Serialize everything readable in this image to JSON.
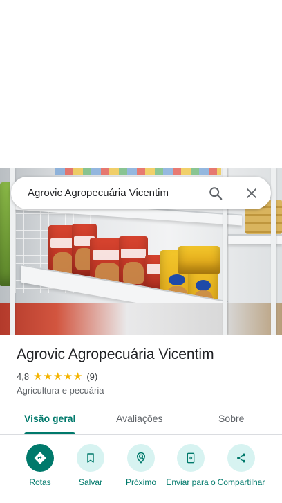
{
  "search": {
    "query": "Agrovic Agropecuária Vicentim",
    "search_icon": "search-icon",
    "close_icon": "close-icon"
  },
  "place": {
    "name": "Agrovic Agropecuária Vicentim",
    "rating": "4,8",
    "stars": 5,
    "review_count": "(9)",
    "category": "Agricultura e pecuária"
  },
  "tabs": [
    {
      "label": "Visão geral",
      "active": true
    },
    {
      "label": "Avaliações",
      "active": false
    },
    {
      "label": "Sobre",
      "active": false
    }
  ],
  "actions": [
    {
      "label": "Rotas",
      "icon": "directions-icon",
      "primary": true
    },
    {
      "label": "Salvar",
      "icon": "bookmark-icon",
      "primary": false
    },
    {
      "label": "Próximo",
      "icon": "nearby-icon",
      "primary": false
    },
    {
      "label": "Enviar para o",
      "icon": "send-to-phone-icon",
      "primary": false
    },
    {
      "label": "Compartilhar",
      "icon": "share-icon",
      "primary": false
    }
  ],
  "colors": {
    "accent": "#00796b",
    "accent_light": "#d7f3f1",
    "star": "#f4b400"
  }
}
